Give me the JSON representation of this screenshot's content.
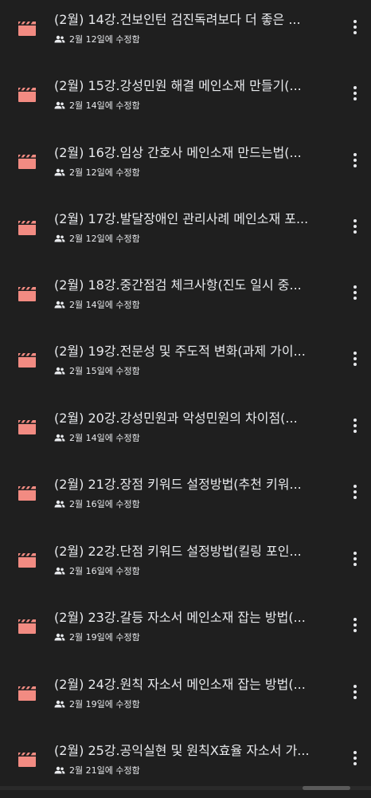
{
  "files": [
    {
      "title": "(2월) 14강.건보인턴 검진독려보다 더 좋은 ...",
      "modified": "2월 12일에 수정함"
    },
    {
      "title": "(2월) 15강.강성민원 해결 메인소재 만들기(...",
      "modified": "2월 14일에 수정함"
    },
    {
      "title": "(2월) 16강.임상 간호사 메인소재 만드는법(...",
      "modified": "2월 12일에 수정함"
    },
    {
      "title": "(2월) 17강.발달장애인 관리사례 메인소재 포...",
      "modified": "2월 12일에 수정함"
    },
    {
      "title": "(2월) 18강.중간점검 체크사항(진도 일시 중...",
      "modified": "2월 14일에 수정함"
    },
    {
      "title": "(2월) 19강.전문성 및 주도적 변화(과제 가이...",
      "modified": "2월 15일에 수정함"
    },
    {
      "title": "(2월) 20강.강성민원과 악성민원의 차이점(...",
      "modified": "2월 14일에 수정함"
    },
    {
      "title": "(2월) 21강.장점 키워드 설정방법(추천 키워...",
      "modified": "2월 16일에 수정함"
    },
    {
      "title": "(2월) 22강.단점 키워드 설정방법(킬링 포인...",
      "modified": "2월 16일에 수정함"
    },
    {
      "title": "(2월) 23강.갈등 자소서 메인소재 잡는 방법(...",
      "modified": "2월 19일에 수정함"
    },
    {
      "title": "(2월) 24강.원칙 자소서 메인소재 잡는 방법(...",
      "modified": "2월 19일에 수정함"
    },
    {
      "title": "(2월) 25강.공익실현 및 원칙X효율 자소서 가...",
      "modified": "2월 21일에 수정함"
    }
  ],
  "colors": {
    "background": "#1f1f1f",
    "video_icon": "#f28b82",
    "text": "#e8eaed"
  },
  "icons": {
    "file_icon": "video-clapperboard-icon",
    "shared_icon": "people-icon",
    "more_icon": "more-vert-icon"
  }
}
